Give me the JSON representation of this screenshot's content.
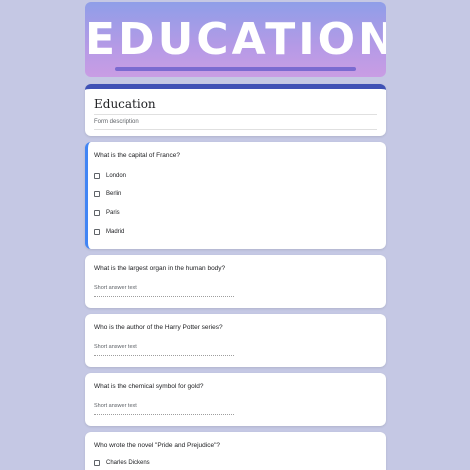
{
  "form": {
    "banner_title": "EDUCATION",
    "title": "Education",
    "description_placeholder": "Form description"
  },
  "questions": [
    {
      "title": "What is the capital of France?",
      "type": "checkbox",
      "options": [
        "London",
        "Berlin",
        "Paris",
        "Madrid"
      ]
    },
    {
      "title": "What is the largest organ in the human body?",
      "type": "short-answer",
      "placeholder": "Short answer text"
    },
    {
      "title": "Who is the author of the Harry Potter series?",
      "type": "short-answer",
      "placeholder": "Short answer text"
    },
    {
      "title": "What is the chemical symbol for gold?",
      "type": "short-answer",
      "placeholder": "Short answer text"
    },
    {
      "title": "Who wrote the novel \"Pride and Prejudice\"?",
      "type": "checkbox",
      "options": [
        "Charles Dickens"
      ]
    }
  ],
  "colors": {
    "background": "#c5c8e4",
    "accent": "#3f51b5",
    "active_question": "#4285f4"
  }
}
